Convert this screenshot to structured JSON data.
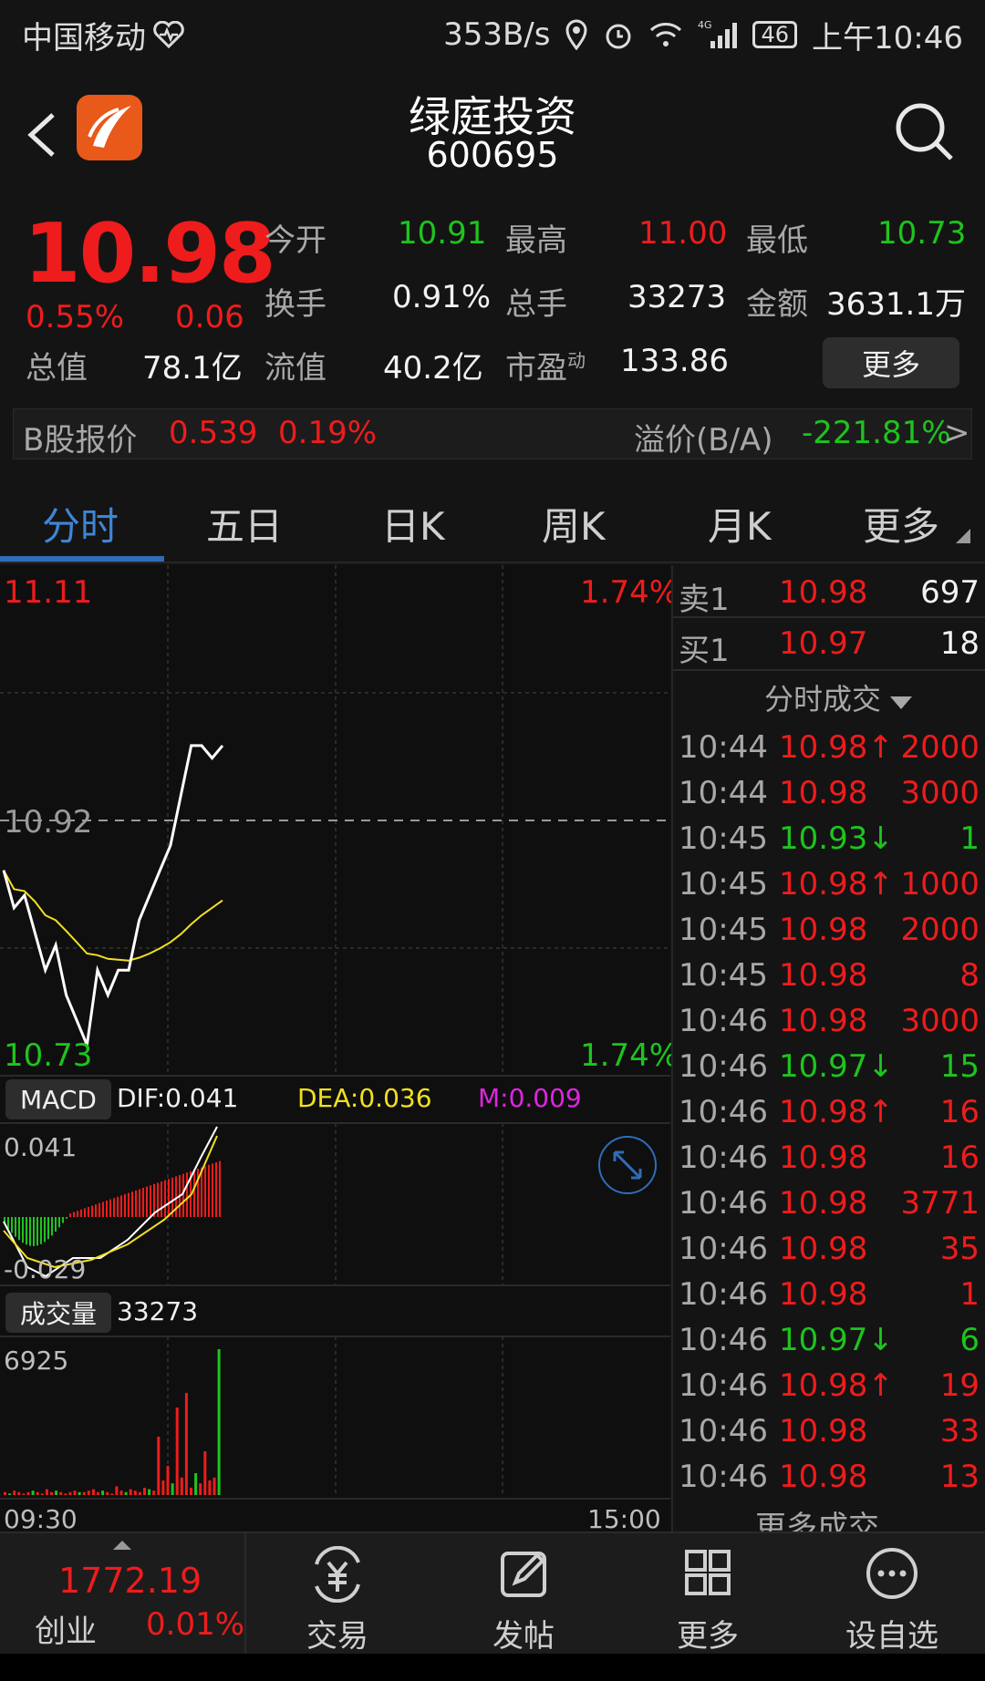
{
  "status_bar": {
    "carrier": "中国移动",
    "speed": "353B/s",
    "network": "4G",
    "battery": "46",
    "time": "上午10:46"
  },
  "header": {
    "title": "绿庭投资",
    "code": "600695"
  },
  "quote": {
    "price": "10.98",
    "change_pct": "0.55%",
    "change": "0.06",
    "fields": [
      {
        "label": "今开",
        "value": "10.91"
      },
      {
        "label": "最高",
        "value": "11.00"
      },
      {
        "label": "最低",
        "value": "10.73"
      },
      {
        "label": "换手",
        "value": "0.91%"
      },
      {
        "label": "总手",
        "value": "33273"
      },
      {
        "label": "金额",
        "value": "3631.1万"
      },
      {
        "label": "总值",
        "value": "78.1亿"
      },
      {
        "label": "流值",
        "value": "40.2亿"
      },
      {
        "label": "市盈",
        "value": "133.86",
        "sup": "动"
      }
    ],
    "more_label": "更多"
  },
  "b_share": {
    "label": "B股报价",
    "price": "0.539",
    "pct": "0.19%",
    "premium_label": "溢价(B/A)",
    "premium_value": "-221.81%",
    "arrow": ">"
  },
  "tabs": [
    "分时",
    "五日",
    "日K",
    "周K",
    "月K",
    "更多"
  ],
  "chart": {
    "high": "11.11",
    "high_pct": "1.74%",
    "mid": "10.92",
    "low": "10.73",
    "low_pct": "1.74%",
    "macd": {
      "label": "MACD",
      "dif": "DIF:0.041",
      "dea": "DEA:0.036",
      "m": "M:0.009",
      "top": "0.041",
      "bottom": "-0.029"
    },
    "volume": {
      "label": "成交量",
      "value": "33273",
      "max": "6925"
    },
    "time_start": "09:30",
    "time_end": "15:00",
    "colors": {
      "price_line": "#ffffff",
      "avg_line": "#f0e020",
      "up": "#ee1c1c",
      "down": "#1ec41e"
    }
  },
  "chart_data": {
    "type": "line",
    "series": [],
    "price_close_approx": [
      10.88,
      10.85,
      10.86,
      10.83,
      10.8,
      10.82,
      10.78,
      10.76,
      10.74,
      10.8,
      10.78,
      10.8,
      10.8,
      10.84,
      10.86,
      10.88,
      10.9,
      10.94,
      10.98,
      10.98,
      10.97,
      10.98
    ],
    "ylim": [
      10.73,
      11.11
    ]
  },
  "order_book": {
    "sell": {
      "label": "卖1",
      "price": "10.98",
      "vol": "697"
    },
    "buy": {
      "label": "买1",
      "price": "10.97",
      "vol": "18"
    }
  },
  "ticks_header": "分时成交",
  "ticks": [
    {
      "t": "10:44",
      "p": "10.98",
      "dir": "↑",
      "v": "2000",
      "c": "red"
    },
    {
      "t": "10:44",
      "p": "10.98",
      "dir": "",
      "v": "3000",
      "c": "red"
    },
    {
      "t": "10:45",
      "p": "10.93",
      "dir": "↓",
      "v": "1",
      "c": "grn"
    },
    {
      "t": "10:45",
      "p": "10.98",
      "dir": "↑",
      "v": "1000",
      "c": "red"
    },
    {
      "t": "10:45",
      "p": "10.98",
      "dir": "",
      "v": "2000",
      "c": "red"
    },
    {
      "t": "10:45",
      "p": "10.98",
      "dir": "",
      "v": "8",
      "c": "red"
    },
    {
      "t": "10:46",
      "p": "10.98",
      "dir": "",
      "v": "3000",
      "c": "red"
    },
    {
      "t": "10:46",
      "p": "10.97",
      "dir": "↓",
      "v": "15",
      "c": "grn"
    },
    {
      "t": "10:46",
      "p": "10.98",
      "dir": "↑",
      "v": "16",
      "c": "red"
    },
    {
      "t": "10:46",
      "p": "10.98",
      "dir": "",
      "v": "16",
      "c": "red"
    },
    {
      "t": "10:46",
      "p": "10.98",
      "dir": "",
      "v": "3771",
      "c": "red"
    },
    {
      "t": "10:46",
      "p": "10.98",
      "dir": "",
      "v": "35",
      "c": "red"
    },
    {
      "t": "10:46",
      "p": "10.98",
      "dir": "",
      "v": "1",
      "c": "red"
    },
    {
      "t": "10:46",
      "p": "10.97",
      "dir": "↓",
      "v": "6",
      "c": "grn"
    },
    {
      "t": "10:46",
      "p": "10.98",
      "dir": "↑",
      "v": "19",
      "c": "red"
    },
    {
      "t": "10:46",
      "p": "10.98",
      "dir": "",
      "v": "33",
      "c": "red"
    },
    {
      "t": "10:46",
      "p": "10.98",
      "dir": "",
      "v": "13",
      "c": "red"
    }
  ],
  "ticks_more": "更多成交",
  "bottom_bar": {
    "index_value": "1772.19",
    "index_name": "创业",
    "index_pct": "0.01%",
    "items": [
      "交易",
      "发帖",
      "更多",
      "设自选"
    ]
  }
}
